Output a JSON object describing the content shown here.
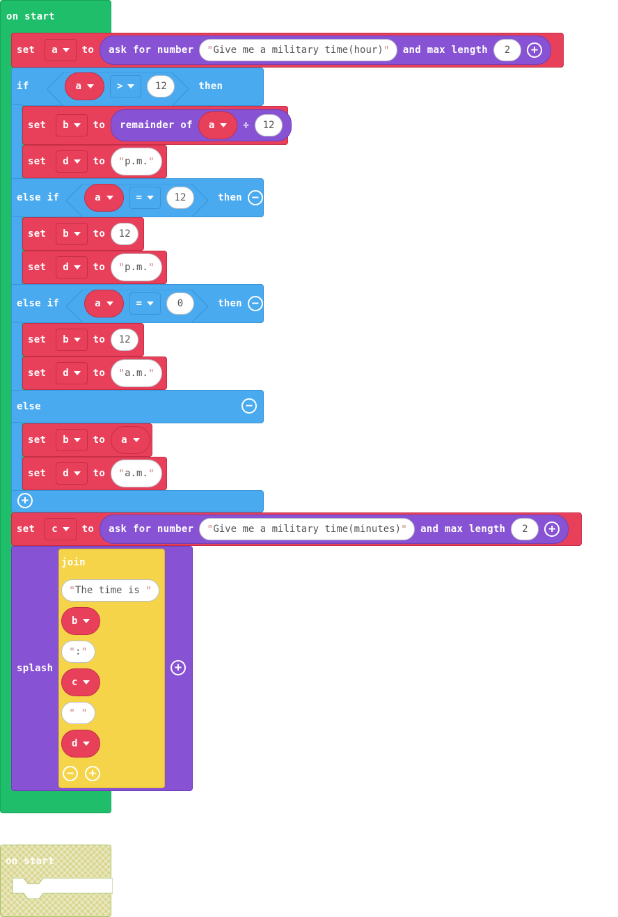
{
  "colors": {
    "event": "#1fbe6a",
    "variables": "#e8405a",
    "logic": "#49aaf0",
    "input": "#8752d4",
    "text": "#f5d44a"
  },
  "event1": {
    "label": "on start"
  },
  "event2": {
    "label": "on start"
  },
  "set_a": {
    "set": "set",
    "var": "a",
    "to": "to",
    "ask": "ask for number",
    "prompt": "Give me a military time(hour)",
    "max": "and max length",
    "len": "2"
  },
  "if1": {
    "if": "if",
    "var": "a",
    "op": ">",
    "val": "12",
    "then": "then"
  },
  "set_b1": {
    "set": "set",
    "var": "b",
    "to": "to",
    "fn": "remainder of",
    "arg": "a",
    "div": "÷",
    "val": "12"
  },
  "set_d1": {
    "set": "set",
    "var": "d",
    "to": "to",
    "val": "p.m."
  },
  "elseif1": {
    "label": "else if",
    "var": "a",
    "op": "=",
    "val": "12",
    "then": "then"
  },
  "set_b2": {
    "set": "set",
    "var": "b",
    "to": "to",
    "val": "12"
  },
  "set_d2": {
    "set": "set",
    "var": "d",
    "to": "to",
    "val": "p.m."
  },
  "elseif2": {
    "label": "else if",
    "var": "a",
    "op": "=",
    "val": "0",
    "then": "then"
  },
  "set_b3": {
    "set": "set",
    "var": "b",
    "to": "to",
    "val": "12"
  },
  "set_d3": {
    "set": "set",
    "var": "d",
    "to": "to",
    "val": "a.m."
  },
  "else1": {
    "label": "else"
  },
  "set_b4": {
    "set": "set",
    "var": "b",
    "to": "to",
    "val": "a"
  },
  "set_d4": {
    "set": "set",
    "var": "d",
    "to": "to",
    "val": "a.m."
  },
  "set_c": {
    "set": "set",
    "var": "c",
    "to": "to",
    "ask": "ask for number",
    "prompt": "Give me a military time(minutes)",
    "max": "and max length",
    "len": "2"
  },
  "splash": {
    "label": "splash",
    "join": "join",
    "s1": "The time is ",
    "v1": "b",
    "s2": ":",
    "v2": "c",
    "s3": " ",
    "v3": "d"
  },
  "icons": {
    "plus": "plus-icon",
    "minus": "minus-icon",
    "caret": "caret-down-icon"
  }
}
